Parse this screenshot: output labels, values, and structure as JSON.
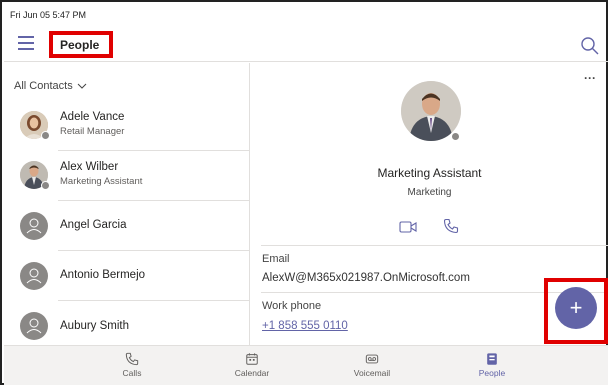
{
  "status_bar": {
    "datetime": "Fri Jun 05  5:47 PM"
  },
  "header": {
    "title": "People",
    "menu_icon": "hamburger-menu-icon",
    "search_icon": "search-icon"
  },
  "contacts": {
    "filter_label": "All Contacts",
    "items": [
      {
        "name": "Adele Vance",
        "role": "Retail Manager"
      },
      {
        "name": "Alex Wilber",
        "role": "Marketing Assistant"
      },
      {
        "name": "Angel Garcia",
        "role": ""
      },
      {
        "name": "Antonio Bermejo",
        "role": ""
      },
      {
        "name": "Aubury Smith",
        "role": ""
      }
    ]
  },
  "profile": {
    "title": "Marketing Assistant",
    "department": "Marketing",
    "email_label": "Email",
    "email_value": "AlexW@M365x021987.OnMicrosoft.com",
    "work_phone_label": "Work phone",
    "work_phone_value": "+1 858 555 0110"
  },
  "fab": {
    "label": "+"
  },
  "nav": [
    {
      "label": "Calls",
      "icon": "phone-icon"
    },
    {
      "label": "Calendar",
      "icon": "calendar-icon"
    },
    {
      "label": "Voicemail",
      "icon": "voicemail-icon"
    },
    {
      "label": "People",
      "icon": "people-icon",
      "active": true
    }
  ],
  "colors": {
    "accent": "#6264a7",
    "highlight": "#e00000"
  }
}
